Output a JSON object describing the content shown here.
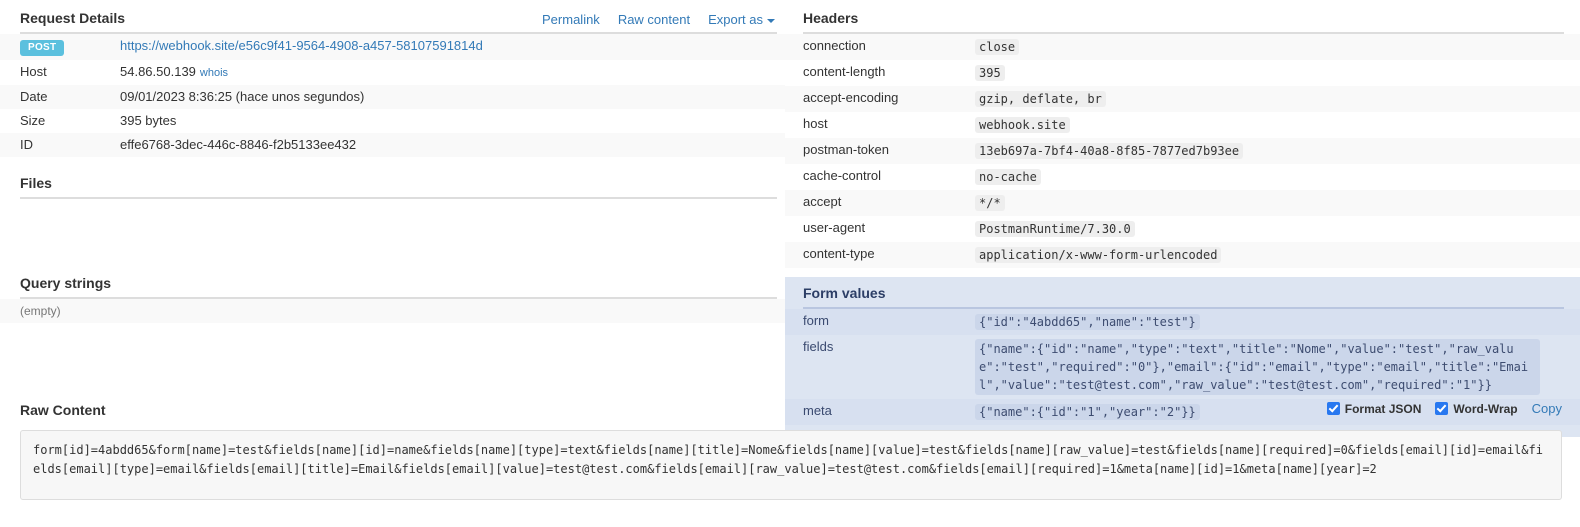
{
  "request_details": {
    "title": "Request Details",
    "actions": [
      {
        "label": "Permalink",
        "name": "permalink-link"
      },
      {
        "label": "Raw content",
        "name": "raw-content-link"
      },
      {
        "label": "Export as",
        "name": "export-as-dropdown"
      }
    ],
    "method": "POST",
    "url": "https://webhook.site/e56c9f41-9564-4908-a457-58107591814d",
    "rows": [
      {
        "key": "Host",
        "value": "54.86.50.139",
        "extra": "whois"
      },
      {
        "key": "Date",
        "value": "09/01/2023 8:36:25 (hace unos segundos)"
      },
      {
        "key": "Size",
        "value": "395 bytes"
      },
      {
        "key": "ID",
        "value": "effe6768-3dec-446c-8846-f2b5133ee432"
      }
    ]
  },
  "files": {
    "title": "Files"
  },
  "query_strings": {
    "title": "Query strings",
    "empty_label": "(empty)"
  },
  "headers": {
    "title": "Headers",
    "rows": [
      {
        "key": "connection",
        "value": "close"
      },
      {
        "key": "content-length",
        "value": "395"
      },
      {
        "key": "accept-encoding",
        "value": "gzip, deflate, br"
      },
      {
        "key": "host",
        "value": "webhook.site"
      },
      {
        "key": "postman-token",
        "value": "13eb697a-7bf4-40a8-8f85-7877ed7b93ee"
      },
      {
        "key": "cache-control",
        "value": "no-cache"
      },
      {
        "key": "accept",
        "value": "*/*"
      },
      {
        "key": "user-agent",
        "value": "PostmanRuntime/7.30.0"
      },
      {
        "key": "content-type",
        "value": "application/x-www-form-urlencoded"
      }
    ]
  },
  "form_values": {
    "title": "Form values",
    "rows": [
      {
        "key": "form",
        "value": "{\"id\":\"4abdd65\",\"name\":\"test\"}"
      },
      {
        "key": "fields",
        "value": "{\"name\":{\"id\":\"name\",\"type\":\"text\",\"title\":\"Nome\",\"value\":\"test\",\"raw_value\":\"test\",\"required\":\"0\"},\"email\":{\"id\":\"email\",\"type\":\"email\",\"title\":\"Email\",\"value\":\"test@test.com\",\"raw_value\":\"test@test.com\",\"required\":\"1\"}}"
      },
      {
        "key": "meta",
        "value": "{\"name\":{\"id\":\"1\",\"year\":\"2\"}}"
      }
    ]
  },
  "raw_content": {
    "title": "Raw Content",
    "format_json_label": "Format JSON",
    "format_json_checked": true,
    "word_wrap_label": "Word-Wrap",
    "word_wrap_checked": true,
    "copy_label": "Copy",
    "body": "form[id]=4abdd65&form[name]=test&fields[name][id]=name&fields[name][type]=text&fields[name][title]=Nome&fields[name][value]=test&fields[name][raw_value]=test&fields[name][required]=0&fields[email][id]=email&fields[email][type]=email&fields[email][title]=Email&fields[email][value]=test@test.com&fields[email][raw_value]=test@test.com&fields[email][required]=1&meta[name][id]=1&meta[name][year]=2"
  },
  "colors": {
    "link": "#337ab7",
    "post_badge": "#5bc0de",
    "form_panel_bg": "#dde5f2",
    "checkbox": "#2878f0"
  }
}
